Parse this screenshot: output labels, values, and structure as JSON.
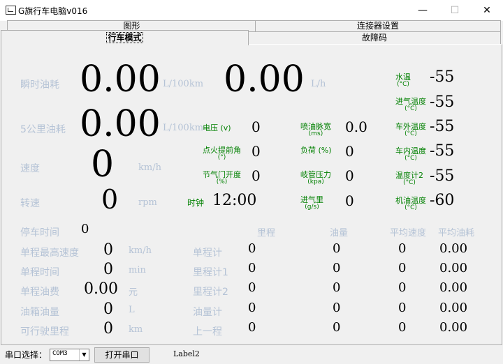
{
  "window": {
    "title": "G旗行车电脑v016",
    "minimize": "—",
    "maximize": "☐",
    "close": "✕"
  },
  "tabs": {
    "row1": [
      "图形",
      "连接器设置"
    ],
    "row2": [
      "行车模式",
      "故障码"
    ]
  },
  "main": {
    "instant_fuel": {
      "label": "瞬时油耗",
      "value1": "0.00",
      "unit1": "L/100km",
      "value2": "0.00",
      "unit2": "L/h"
    },
    "fuel_5km": {
      "label": "5公里油耗",
      "value": "0.00",
      "unit": "L/100km"
    },
    "speed": {
      "label": "速度",
      "value": "0",
      "unit": "km/h"
    },
    "rpm": {
      "label": "转速",
      "value": "0",
      "unit": "rpm"
    },
    "clock": {
      "label": "时钟",
      "value": "12:00"
    }
  },
  "params_mid": [
    {
      "label": "电压",
      "sub": "(v)",
      "value": "0"
    },
    {
      "label": "点火提前角",
      "sub": "(°)",
      "value": "0"
    },
    {
      "label": "节气门开度",
      "sub": "(%)",
      "value": "0"
    },
    {
      "label": "喷油脉宽",
      "sub": "(ms)",
      "value": "0.0"
    },
    {
      "label": "负荷",
      "sub": "(%)",
      "value": "0"
    },
    {
      "label": "岐管压力",
      "sub": "(kpa)",
      "value": "0"
    },
    {
      "label": "进气里",
      "sub": "(g/s)",
      "value": "0"
    }
  ],
  "temps": [
    {
      "label": "水温",
      "sub": "(°C)",
      "value": "-55"
    },
    {
      "label": "进气温度",
      "sub": "(°C)",
      "value": "-55"
    },
    {
      "label": "车外温度",
      "sub": "(°C)",
      "value": "-55"
    },
    {
      "label": "车内温度",
      "sub": "(°C)",
      "value": "-55"
    },
    {
      "label": "温度计2",
      "sub": "(°C)",
      "value": "-55"
    },
    {
      "label": "机油温度",
      "sub": "(°C)",
      "value": "-60"
    }
  ],
  "trip": {
    "stop_time": {
      "label": "停车时间",
      "value": "0"
    },
    "rows": [
      {
        "label": "单程最高速度",
        "value": "0",
        "unit": "km/h"
      },
      {
        "label": "单程时间",
        "value": "0",
        "unit": "min"
      },
      {
        "label": "单程油费",
        "value": "0.00",
        "unit": "元"
      },
      {
        "label": "油箱油量",
        "value": "0",
        "unit": "L"
      },
      {
        "label": "可行驶里程",
        "value": "0",
        "unit": "km"
      }
    ]
  },
  "odometer": {
    "headers": [
      "里程",
      "油量",
      "平均速度",
      "平均油耗"
    ],
    "rows": [
      {
        "label": "单程计",
        "values": [
          "0",
          "0",
          "0",
          "0.00"
        ]
      },
      {
        "label": "里程计1",
        "values": [
          "0",
          "0",
          "0",
          "0.00"
        ]
      },
      {
        "label": "里程计2",
        "values": [
          "0",
          "0",
          "0",
          "0.00"
        ]
      },
      {
        "label": "油量计",
        "values": [
          "0",
          "0",
          "0",
          "0.00"
        ]
      },
      {
        "label": "上一程",
        "values": [
          "0",
          "0",
          "0",
          "0.00"
        ]
      }
    ]
  },
  "bottom": {
    "port_label": "串口选择：",
    "port_value": "COM3",
    "open_button": "打开串口",
    "status_label": "Label2"
  }
}
